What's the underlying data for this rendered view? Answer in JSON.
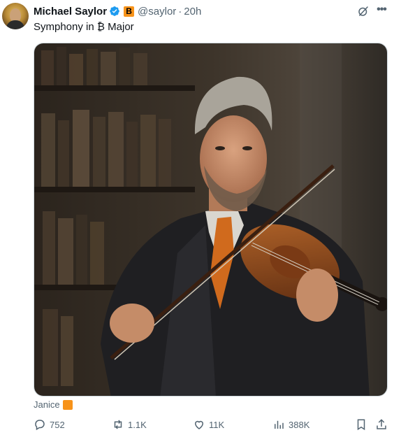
{
  "tweet": {
    "author_name": "Michael Saylor",
    "author_badge_text": "B",
    "handle": "@saylor",
    "separator": "·",
    "time": "20h",
    "text": "Symphony in ₿ Major",
    "media_caption": "Janice"
  },
  "actions": {
    "replies": "752",
    "reposts": "1.1K",
    "likes": "11K",
    "views": "388K"
  },
  "icons": {
    "verified": "verified-badge-icon",
    "grok": "grok-icon",
    "more": "more-icon",
    "reply": "reply-icon",
    "repost": "repost-icon",
    "like": "heart-icon",
    "views": "analytics-icon",
    "bookmark": "bookmark-icon",
    "share": "share-icon"
  },
  "colors": {
    "bitcoin_orange": "#f7931a",
    "verified_blue": "#1d9bf0",
    "muted_text": "#536471",
    "primary_text": "#0f1419"
  }
}
